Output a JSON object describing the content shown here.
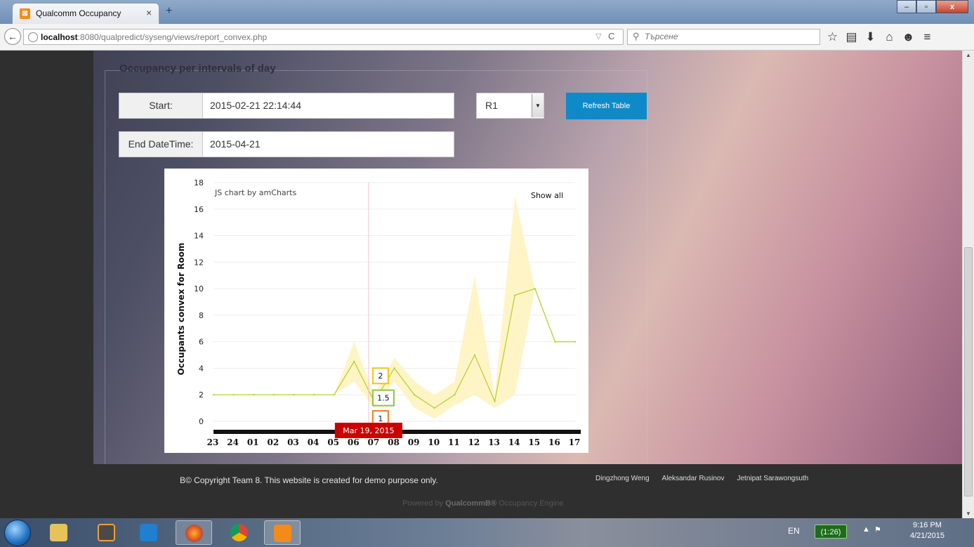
{
  "browser": {
    "tab_title": "Qualcomm Occupancy",
    "tab_close": "×",
    "new_tab": "+",
    "url_host": "localhost",
    "url_rest": ":8080/qualpredict/syseng/views/report_convex.php",
    "search_placeholder": "Търсене",
    "win_minimize": "–",
    "win_maximize": "▫",
    "win_close": "x"
  },
  "form": {
    "legend": "Occupancy per intervals of day",
    "start_label": "Start:",
    "start_value": "2015-02-21 22:14:44",
    "end_label": "End DateTime:",
    "end_value": "2015-04-21",
    "room_selected": "R1",
    "refresh_label": "Refresh Table"
  },
  "chart_data": {
    "type": "line",
    "credit": "JS chart by amCharts",
    "show_all": "Show all",
    "ylabel": "Occupants convex for Room",
    "ylim": [
      0,
      18
    ],
    "yticks": [
      "0",
      "2",
      "4",
      "6",
      "8",
      "10",
      "12",
      "14",
      "16",
      "18"
    ],
    "x_tick_labels": [
      "23",
      "24",
      "01",
      "02",
      "03",
      "04",
      "05",
      "06",
      "07",
      "08",
      "09",
      "10",
      "11",
      "12",
      "13",
      "14",
      "15",
      "16",
      "17"
    ],
    "cursor_date": "Mar 19, 2015",
    "cursor_values": {
      "high": "2",
      "mid": "1.5",
      "low": "1"
    },
    "colors": {
      "line": "#b5d334",
      "band": "#fff3c0",
      "cursor_high": "#f0c419",
      "cursor_mid": "#8dc63f",
      "cursor_low": "#f47b20",
      "cursor_date_bg": "#cc0000"
    },
    "series": [
      {
        "role": "line",
        "values": [
          2,
          2,
          2,
          2,
          2,
          2,
          2,
          4.5,
          1.5,
          4,
          2,
          1,
          2,
          5,
          1.5,
          9.5,
          10,
          6,
          6
        ]
      },
      {
        "role": "upper",
        "values": [
          2,
          2,
          2,
          2,
          2,
          2,
          2,
          6,
          2,
          4.8,
          3,
          2,
          3,
          11,
          2,
          17,
          10,
          6,
          6
        ]
      },
      {
        "role": "lower",
        "values": [
          2,
          2,
          2,
          2,
          2,
          2,
          2,
          3,
          1,
          3,
          1,
          0.2,
          1.2,
          2,
          1,
          2,
          10,
          6,
          6
        ]
      }
    ]
  },
  "footer": {
    "copyright": "В© Copyright Team 8. This website is created for demo purpose only.",
    "authors": [
      "Dingzhong Weng",
      "Aleksandar Rusinov",
      "Jetnipat Sarawongsuth"
    ],
    "powered_prefix": "Powered by ",
    "powered_brand": "QualcommВ®",
    "powered_suffix": " Occupancy Engine"
  },
  "taskbar": {
    "lang": "EN",
    "battery": "(1:26)",
    "time": "9:16 PM",
    "date": "4/21/2015"
  }
}
